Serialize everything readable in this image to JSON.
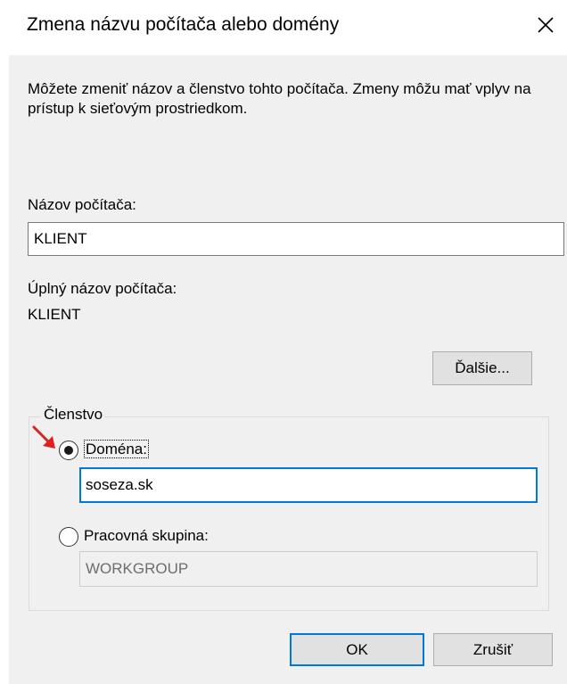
{
  "dialog": {
    "title": "Zmena názvu počítača alebo domény",
    "description": "Môžete zmeniť názov a členstvo tohto počítača. Zmeny môžu mať vplyv na prístup k sieťovým prostriedkom.",
    "computer_name_label": "Názov počítača:",
    "computer_name_value": "KLIENT",
    "full_name_label": "Úplný názov počítača:",
    "full_name_value": "KLIENT",
    "more_button": "Ďalšie...",
    "membership": {
      "group_label": "Členstvo",
      "domain_label": "Doména:",
      "domain_value": "soseza.sk",
      "domain_selected": true,
      "workgroup_label": "Pracovná skupina:",
      "workgroup_value": "WORKGROUP"
    },
    "ok_button": "OK",
    "cancel_button": "Zrušiť"
  },
  "colors": {
    "accent": "#0078d7",
    "dialog_background": "#f0f0f0",
    "annotation_arrow": "#e02020"
  },
  "icons": {
    "close": "close-icon",
    "annotation": "red-arrow-icon"
  }
}
